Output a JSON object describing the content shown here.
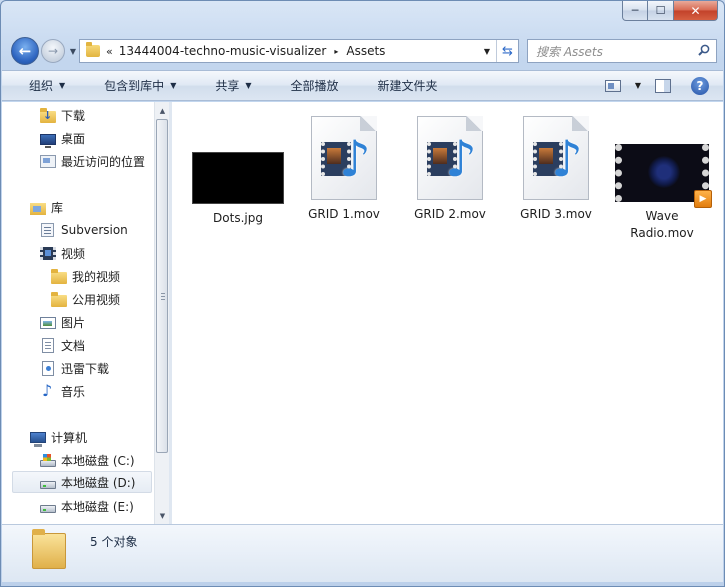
{
  "window": {
    "caption_buttons": {
      "minimize": "─",
      "maximize": "☐",
      "close": "✕"
    }
  },
  "address_bar": {
    "overflow": "«",
    "segments": [
      "13444004-techno-music-visualizer",
      "Assets"
    ],
    "separator": "▸"
  },
  "search": {
    "placeholder": "搜索 Assets"
  },
  "toolbar": {
    "items": [
      {
        "label": "组织",
        "has_dropdown": true
      },
      {
        "label": "包含到库中",
        "has_dropdown": true
      },
      {
        "label": "共享",
        "has_dropdown": true
      },
      {
        "label": "全部播放",
        "has_dropdown": false
      },
      {
        "label": "新建文件夹",
        "has_dropdown": false
      }
    ],
    "help": "?"
  },
  "nav_tree": [
    {
      "label": "下载",
      "icon": "download-folder-icon",
      "level": 1
    },
    {
      "label": "桌面",
      "icon": "desktop-icon",
      "level": 1
    },
    {
      "label": "最近访问的位置",
      "icon": "recent-places-icon",
      "level": 1
    },
    {
      "label": "库",
      "icon": "library-icon",
      "level": 0
    },
    {
      "label": "Subversion",
      "icon": "subversion-icon",
      "level": 1
    },
    {
      "label": "视频",
      "icon": "video-library-icon",
      "level": 1
    },
    {
      "label": "我的视频",
      "icon": "folder-icon",
      "level": 2
    },
    {
      "label": "公用视频",
      "icon": "folder-icon",
      "level": 2
    },
    {
      "label": "图片",
      "icon": "pictures-icon",
      "level": 1
    },
    {
      "label": "文档",
      "icon": "documents-icon",
      "level": 1
    },
    {
      "label": "迅雷下载",
      "icon": "thunder-download-icon",
      "level": 1
    },
    {
      "label": "音乐",
      "icon": "music-icon",
      "level": 1
    },
    {
      "label": "计算机",
      "icon": "computer-icon",
      "level": 0
    },
    {
      "label": "本地磁盘 (C:)",
      "icon": "system-drive-icon",
      "level": 1
    },
    {
      "label": "本地磁盘 (D:)",
      "icon": "drive-icon",
      "level": 1,
      "selected": true
    },
    {
      "label": "本地磁盘 (E:)",
      "icon": "drive-icon",
      "level": 1
    }
  ],
  "files": [
    {
      "name": "Dots.jpg",
      "kind": "image"
    },
    {
      "name": "GRID 1.mov",
      "kind": "movie"
    },
    {
      "name": "GRID 2.mov",
      "kind": "movie"
    },
    {
      "name": "GRID 3.mov",
      "kind": "movie"
    },
    {
      "name_line1": "Wave",
      "name_line2": "Radio.mov",
      "kind": "video-thumbnail"
    }
  ],
  "status": {
    "text": "5 个对象"
  }
}
